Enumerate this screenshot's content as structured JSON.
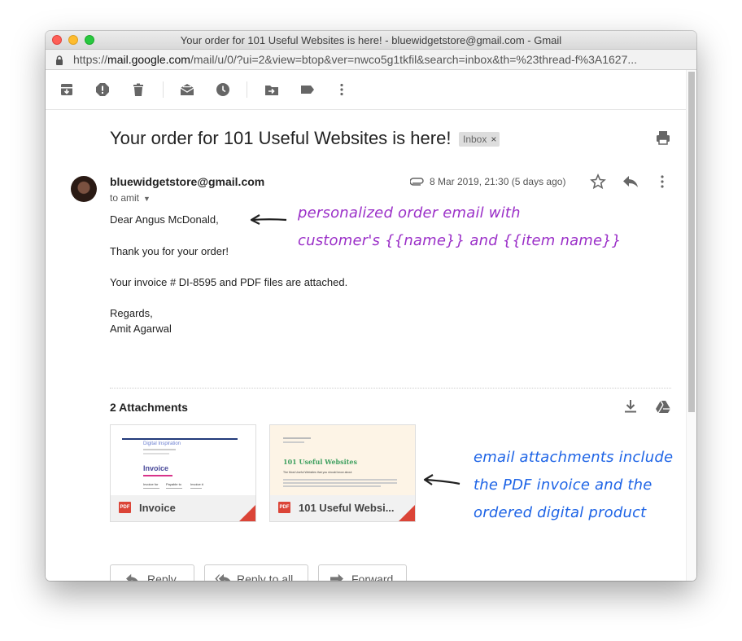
{
  "window": {
    "title": "Your order for 101 Useful Websites is here! - bluewidgetstore@gmail.com - Gmail"
  },
  "address_bar": {
    "protocol": "https://",
    "host": "mail.google.com",
    "path": "/mail/u/0/?ui=2&view=btop&ver=nwco5g1tkfil&search=inbox&th=%23thread-f%3A1627..."
  },
  "toolbar": {
    "icons": [
      "archive-icon",
      "report-spam-icon",
      "delete-icon",
      "mark-unread-icon",
      "snooze-icon",
      "move-to-icon",
      "labels-icon",
      "more-vert-icon"
    ]
  },
  "email": {
    "subject": "Your order for 101 Useful Websites is here!",
    "label": "Inbox",
    "label_close": "×",
    "sender": "bluewidgetstore@gmail.com",
    "to": "to amit",
    "date": "8 Mar 2019, 21:30 (5 days ago)",
    "body": {
      "greeting": "Dear Angus McDonald,",
      "line1": "Thank you for your order!",
      "line2": "Your invoice # DI-8595 and PDF files are attached.",
      "closing": "Regards,",
      "signature": "Amit Agarwal"
    }
  },
  "attachments": {
    "title": "2 Attachments",
    "items": [
      {
        "name": "Invoice",
        "type": "PDF",
        "preview": {
          "company": "Digital Inspiration",
          "heading": "Invoice",
          "col1": "Invoice for",
          "col2": "Payable to",
          "col3": "Invoice #"
        }
      },
      {
        "name": "101 Useful Websi...",
        "type": "PDF",
        "preview": {
          "heading": "101 Useful Websites",
          "subheading": "The Most Useful Websites that you should know about"
        }
      }
    ]
  },
  "actions": {
    "reply": "Reply",
    "reply_all": "Reply to all",
    "forward": "Forward"
  },
  "annotations": {
    "top_line1": "personalized order email with",
    "top_line2": "customer's {{name}} and {{item name}}",
    "bottom_line1": "email attachments include",
    "bottom_line2": "the PDF invoice and the",
    "bottom_line3": "ordered digital product"
  },
  "colors": {
    "annotation_purple": "#9b30c8",
    "annotation_blue": "#1e64e6",
    "pdf_red": "#db4437"
  }
}
